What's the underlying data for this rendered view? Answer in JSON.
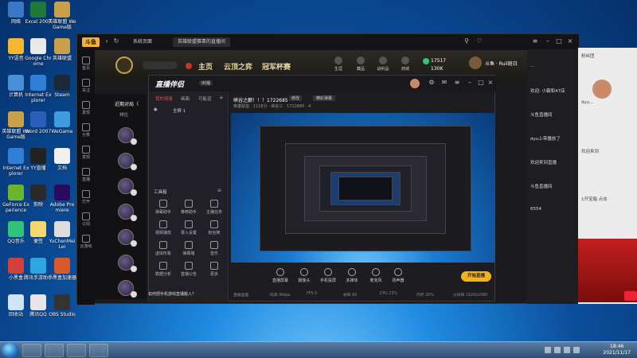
{
  "desktop": {
    "icons": [
      {
        "label": "网络",
        "color": "#3a78c4"
      },
      {
        "label": "Excel 2007",
        "color": "#1f7a3a"
      },
      {
        "label": "英雄联盟 WeGame版",
        "color": "#c8a04a"
      },
      {
        "label": "YY语音",
        "color": "#f2b82e"
      },
      {
        "label": "Google Chrome",
        "color": "#e9e9e9"
      },
      {
        "label": "英雄联盟",
        "color": "#c8a04a"
      },
      {
        "label": "计算机",
        "color": "#4a90d9"
      },
      {
        "label": "Internet Explorer",
        "color": "#2f7fd6"
      },
      {
        "label": "Steam",
        "color": "#1b2838"
      },
      {
        "label": "英雄联盟 WeGame版",
        "color": "#c8a04a"
      },
      {
        "label": "Word 2007",
        "color": "#2b5eb8"
      },
      {
        "label": "WeGame",
        "color": "#3e9be0"
      },
      {
        "label": "Internet Explorer",
        "color": "#2f7fd6"
      },
      {
        "label": "YY直播",
        "color": "#222"
      },
      {
        "label": "文档",
        "color": "#f0f0f0"
      },
      {
        "label": "GeForce Experience",
        "color": "#6ab42e"
      },
      {
        "label": "剪映",
        "color": "#2a2a2a"
      },
      {
        "label": "Adobe Premiere",
        "color": "#2a0a5c"
      },
      {
        "label": "QQ音乐",
        "color": "#31c27c"
      },
      {
        "label": "便签",
        "color": "#f5d76e"
      },
      {
        "label": "YuChenMeiLei",
        "color": "#ddd"
      },
      {
        "label": "小黑盒",
        "color": "#d2403a"
      },
      {
        "label": "腾讯手游助手",
        "color": "#2ea7e0"
      },
      {
        "label": "小黑盒加速器",
        "color": "#d65a2a"
      },
      {
        "label": "回收站",
        "color": "#cfe4f6"
      },
      {
        "label": "腾讯QQ",
        "color": "#e6e6e6"
      },
      {
        "label": "OBS Studio",
        "color": "#333"
      }
    ]
  },
  "taskbar": {
    "time": "18:46",
    "date": "2021/11/17"
  },
  "app": {
    "title_tab1": "系统页面",
    "title_tab2": "英雄联盟赛事的直播间",
    "left_items": [
      "首页",
      "关注",
      "发现",
      "分类",
      "发现",
      "直播",
      "打开",
      "订阅",
      "云游戏"
    ],
    "game_nav": [
      "主页",
      "云顶之弈",
      "冠军杯赛"
    ],
    "game_icons": [
      "生涯",
      "藏品",
      "战利品",
      "商城"
    ],
    "coins1": "17517",
    "coins2": "130K",
    "user": "斗鱼 · Ruil斑日",
    "hero_list_title": "近期对局（",
    "hero_list_tab": "排位",
    "chat_lines": [
      "...",
      "欢迎: 小霸和47店",
      "斗鱼直播间",
      "dyu上带播放了",
      "欢迎来到直播",
      "斗鱼直播间",
      "6554"
    ],
    "right_panel": [
      "粉丝团",
      "dyu...",
      "欢迎来到",
      "1开宝箱 点击"
    ],
    "warn_text": "如何把手机游戏直播搬入？"
  },
  "obs": {
    "logo": "直播伴侣",
    "badge": "90版",
    "side_tabs": [
      "我的场景",
      "画面",
      "可能道"
    ],
    "scene": "全屏 1",
    "tool_title": "工具箱",
    "tools": [
      "弹幕助手",
      "推荐助手",
      "主播任务",
      "视频播放",
      "录入设置",
      "粉丝牌",
      "虚拟形象",
      "弹幕墙",
      "音乐",
      "数据分析",
      "直播公告",
      "更多"
    ],
    "stage_title": "峡谷之巅！！！1722685",
    "stage_edit": "修改",
    "stage_tag": "精彩弹幕",
    "stage_sub": "英雄联盟 · 1118分 · 峡谷三 · 1722685 · 4",
    "bottom_buttons": [
      "直播屏幕",
      "摄像头",
      "手机投屏",
      "多媒体",
      "麦克风",
      "扬声器"
    ],
    "live_button": "开始直播",
    "status_items": [
      "直播画面",
      "码率 0kbps",
      "FPS 0",
      "帧率 60",
      "CPU 23%",
      "内存 26%",
      "分辨率 1920x1080"
    ]
  }
}
